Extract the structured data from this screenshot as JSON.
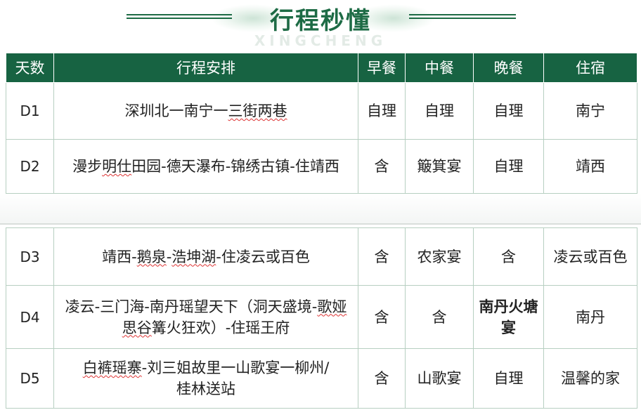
{
  "title": {
    "main": "行程秒懂",
    "sub": "XINGCHENG"
  },
  "headers": {
    "day": "天数",
    "plan": "行程安排",
    "breakfast": "早餐",
    "lunch": "中餐",
    "dinner": "晚餐",
    "stay": "住宿"
  },
  "rows": [
    {
      "day": "D1",
      "plan_a": "深圳北一南宁一",
      "plan_b": "三街两巷",
      "breakfast": "自理",
      "lunch": "自理",
      "dinner": "自理",
      "stay": "南宁"
    },
    {
      "day": "D2",
      "plan_a": "漫步",
      "plan_b": "明仕",
      "plan_c": "田园-德天瀑布-锦绣古镇-住靖西",
      "breakfast": "含",
      "lunch": "簸箕宴",
      "dinner": "自理",
      "stay": "靖西"
    },
    {
      "day": "D3",
      "plan_a": "靖西-",
      "plan_b": "鹅泉",
      "plan_c": "-",
      "plan_d": "浩坤湖",
      "plan_e": "-住凌云或百色",
      "breakfast": "含",
      "lunch": "农家宴",
      "dinner": "含",
      "stay": "凌云或百色"
    },
    {
      "day": "D4",
      "plan_a": "凌云-三门海-南丹瑶望天下（洞天盛境-",
      "plan_b": "歌娅思谷",
      "plan_c": "篝火狂欢）-住瑶王府",
      "breakfast": "含",
      "lunch": "含",
      "dinner": "南丹火塘宴",
      "stay": "南丹"
    },
    {
      "day": "D5",
      "plan_a": "白裤瑶寨",
      "plan_b": "-刘三姐故里一山歌宴一柳州/",
      "plan_c": "桂林送站",
      "breakfast": "含",
      "lunch": "山歌宴",
      "dinner": "自理",
      "stay": "温馨的家"
    }
  ],
  "colors": {
    "header_bg": "#176342",
    "title": "#1d6b45",
    "border": "#b7cfc1"
  }
}
